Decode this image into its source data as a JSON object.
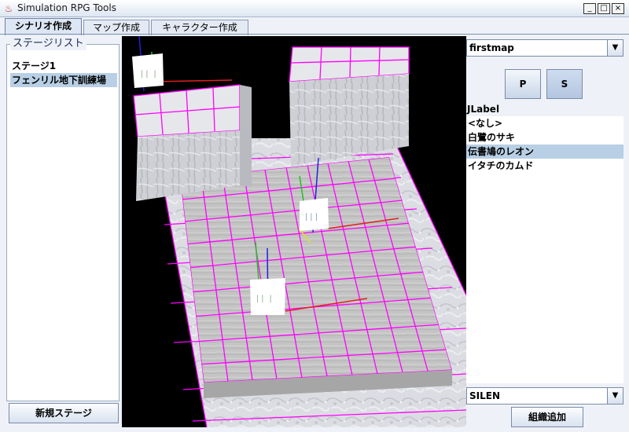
{
  "window": {
    "title": "Simulation RPG Tools",
    "minimize": "_",
    "maximize": "□",
    "close": "×"
  },
  "tabs": [
    {
      "label": "シナリオ作成",
      "active": true
    },
    {
      "label": "マップ作成",
      "active": false
    },
    {
      "label": "キャラクター作成",
      "active": false
    }
  ],
  "stages": {
    "legend": "ステージリスト",
    "items": [
      "ステージ1",
      "フェンリル地下訓練場"
    ],
    "selected_index": 1,
    "new_button": "新規ステージ"
  },
  "map_select": {
    "value": "firstmap"
  },
  "buttons": {
    "p": "P",
    "s": "S"
  },
  "characters": {
    "label": "JLabel",
    "items": [
      "<なし>",
      "白鷺のサキ",
      "伝書鳩のレオン",
      "イタチのカムド"
    ],
    "selected_index": 2
  },
  "org_select": {
    "value": "SILEN"
  },
  "add_org_button": "組織追加",
  "colors": {
    "grid_line": "#ff00ff",
    "selection": "#b8cfe5",
    "floor": "#c8c8c8",
    "axis_x": "#d01010",
    "axis_y": "#10b010",
    "axis_z": "#1010d0"
  },
  "icons": {
    "app": "java-cup-icon",
    "dropdown": "triangle-down-icon"
  }
}
